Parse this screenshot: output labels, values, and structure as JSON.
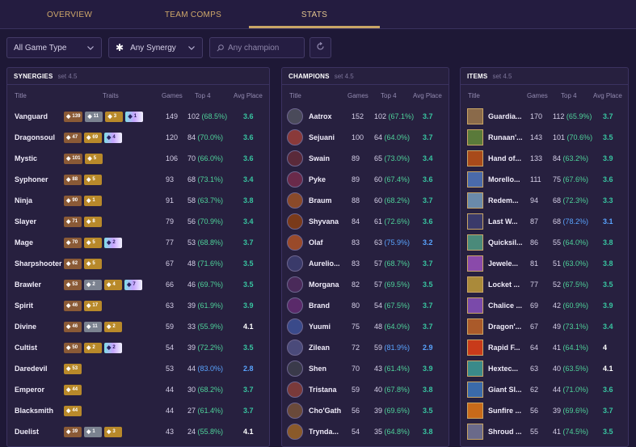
{
  "nav": {
    "tabs": [
      {
        "label": "OVERVIEW"
      },
      {
        "label": "TEAM COMPS"
      },
      {
        "label": "STATS"
      }
    ]
  },
  "filters": {
    "game_type": "All Game Type",
    "synergy": "Any Synergy",
    "champion_placeholder": "Any champion"
  },
  "synergies": {
    "title": "SYNERGIES",
    "set": "set 4.5",
    "cols": {
      "title": "Title",
      "traits": "Traits",
      "games": "Games",
      "top4": "Top 4",
      "avg": "Avg Place"
    },
    "rows": [
      {
        "name": "Vanguard",
        "traits": [
          {
            "tier": "bronze",
            "count": "139"
          },
          {
            "tier": "silver",
            "count": "11"
          },
          {
            "tier": "gold",
            "count": "3"
          },
          {
            "tier": "chromatic",
            "count": "1"
          }
        ],
        "games": "149",
        "top4": "102",
        "pct": "(68.5%)",
        "avg": "3.6"
      },
      {
        "name": "Dragonsoul",
        "traits": [
          {
            "tier": "bronze",
            "count": "47"
          },
          {
            "tier": "gold",
            "count": "69"
          },
          {
            "tier": "chromatic",
            "count": "4"
          }
        ],
        "games": "120",
        "top4": "84",
        "pct": "(70.0%)",
        "avg": "3.6"
      },
      {
        "name": "Mystic",
        "traits": [
          {
            "tier": "bronze",
            "count": "101"
          },
          {
            "tier": "gold",
            "count": "5"
          }
        ],
        "games": "106",
        "top4": "70",
        "pct": "(66.0%)",
        "avg": "3.6"
      },
      {
        "name": "Syphoner",
        "traits": [
          {
            "tier": "bronze",
            "count": "88"
          },
          {
            "tier": "gold",
            "count": "5"
          }
        ],
        "games": "93",
        "top4": "68",
        "pct": "(73.1%)",
        "avg": "3.4"
      },
      {
        "name": "Ninja",
        "traits": [
          {
            "tier": "bronze",
            "count": "90"
          },
          {
            "tier": "gold",
            "count": "1"
          }
        ],
        "games": "91",
        "top4": "58",
        "pct": "(63.7%)",
        "avg": "3.8"
      },
      {
        "name": "Slayer",
        "traits": [
          {
            "tier": "bronze",
            "count": "71"
          },
          {
            "tier": "gold",
            "count": "8"
          }
        ],
        "games": "79",
        "top4": "56",
        "pct": "(70.9%)",
        "avg": "3.4"
      },
      {
        "name": "Mage",
        "traits": [
          {
            "tier": "bronze",
            "count": "70"
          },
          {
            "tier": "gold",
            "count": "5"
          },
          {
            "tier": "chromatic",
            "count": "2"
          }
        ],
        "games": "77",
        "top4": "53",
        "pct": "(68.8%)",
        "avg": "3.7"
      },
      {
        "name": "Sharpshooter",
        "traits": [
          {
            "tier": "bronze",
            "count": "62"
          },
          {
            "tier": "gold",
            "count": "5"
          }
        ],
        "games": "67",
        "top4": "48",
        "pct": "(71.6%)",
        "avg": "3.5"
      },
      {
        "name": "Brawler",
        "traits": [
          {
            "tier": "bronze",
            "count": "53"
          },
          {
            "tier": "silver",
            "count": "2"
          },
          {
            "tier": "gold",
            "count": "4"
          },
          {
            "tier": "chromatic",
            "count": "7"
          }
        ],
        "games": "66",
        "top4": "46",
        "pct": "(69.7%)",
        "avg": "3.5"
      },
      {
        "name": "Spirit",
        "traits": [
          {
            "tier": "bronze",
            "count": "46"
          },
          {
            "tier": "gold",
            "count": "17"
          }
        ],
        "games": "63",
        "top4": "39",
        "pct": "(61.9%)",
        "avg": "3.9"
      },
      {
        "name": "Divine",
        "traits": [
          {
            "tier": "bronze",
            "count": "46"
          },
          {
            "tier": "silver",
            "count": "11"
          },
          {
            "tier": "gold",
            "count": "2"
          }
        ],
        "games": "59",
        "top4": "33",
        "pct": "(55.9%)",
        "avg": "4.1"
      },
      {
        "name": "Cultist",
        "traits": [
          {
            "tier": "bronze",
            "count": "50"
          },
          {
            "tier": "gold",
            "count": "2"
          },
          {
            "tier": "chromatic",
            "count": "2"
          }
        ],
        "games": "54",
        "top4": "39",
        "pct": "(72.2%)",
        "avg": "3.5"
      },
      {
        "name": "Daredevil",
        "traits": [
          {
            "tier": "gold",
            "count": "53"
          }
        ],
        "games": "53",
        "top4": "44",
        "pct": "(83.0%)",
        "avg": "2.8"
      },
      {
        "name": "Emperor",
        "traits": [
          {
            "tier": "gold",
            "count": "44"
          }
        ],
        "games": "44",
        "top4": "30",
        "pct": "(68.2%)",
        "avg": "3.7"
      },
      {
        "name": "Blacksmith",
        "traits": [
          {
            "tier": "gold",
            "count": "44"
          }
        ],
        "games": "44",
        "top4": "27",
        "pct": "(61.4%)",
        "avg": "3.7"
      },
      {
        "name": "Duelist",
        "traits": [
          {
            "tier": "bronze",
            "count": "39"
          },
          {
            "tier": "silver",
            "count": "1"
          },
          {
            "tier": "gold",
            "count": "3"
          }
        ],
        "games": "43",
        "top4": "24",
        "pct": "(55.8%)",
        "avg": "4.1"
      }
    ]
  },
  "champions": {
    "title": "CHAMPIONS",
    "set": "set 4.5",
    "cols": {
      "title": "Title",
      "games": "Games",
      "top4": "Top 4",
      "avg": "Avg Place"
    },
    "rows": [
      {
        "name": "Aatrox",
        "color": "#4a4a5a",
        "games": "152",
        "top4": "102",
        "pct": "(67.1%)",
        "avg": "3.7"
      },
      {
        "name": "Sejuani",
        "color": "#8a3a3a",
        "games": "100",
        "top4": "64",
        "pct": "(64.0%)",
        "avg": "3.7"
      },
      {
        "name": "Swain",
        "color": "#5a2a3a",
        "games": "89",
        "top4": "65",
        "pct": "(73.0%)",
        "avg": "3.4"
      },
      {
        "name": "Pyke",
        "color": "#6a2a4a",
        "games": "89",
        "top4": "60",
        "pct": "(67.4%)",
        "avg": "3.6"
      },
      {
        "name": "Braum",
        "color": "#8a4a2a",
        "games": "88",
        "top4": "60",
        "pct": "(68.2%)",
        "avg": "3.7"
      },
      {
        "name": "Shyvana",
        "color": "#7a3a1a",
        "games": "84",
        "top4": "61",
        "pct": "(72.6%)",
        "avg": "3.6"
      },
      {
        "name": "Olaf",
        "color": "#9a4a2a",
        "games": "83",
        "top4": "63",
        "pct": "(75.9%)",
        "avg": "3.2"
      },
      {
        "name": "Aurelio...",
        "color": "#3a3a6a",
        "games": "83",
        "top4": "57",
        "pct": "(68.7%)",
        "avg": "3.7"
      },
      {
        "name": "Morgana",
        "color": "#4a2a5a",
        "games": "82",
        "top4": "57",
        "pct": "(69.5%)",
        "avg": "3.5"
      },
      {
        "name": "Brand",
        "color": "#5a2a6a",
        "games": "80",
        "top4": "54",
        "pct": "(67.5%)",
        "avg": "3.7"
      },
      {
        "name": "Yuumi",
        "color": "#3a4a8a",
        "games": "75",
        "top4": "48",
        "pct": "(64.0%)",
        "avg": "3.7"
      },
      {
        "name": "Zilean",
        "color": "#4a4a7a",
        "games": "72",
        "top4": "59",
        "pct": "(81.9%)",
        "avg": "2.9"
      },
      {
        "name": "Shen",
        "color": "#3a3a4a",
        "games": "70",
        "top4": "43",
        "pct": "(61.4%)",
        "avg": "3.9"
      },
      {
        "name": "Tristana",
        "color": "#7a3a3a",
        "games": "59",
        "top4": "40",
        "pct": "(67.8%)",
        "avg": "3.8"
      },
      {
        "name": "Cho'Gath",
        "color": "#6a4a3a",
        "games": "56",
        "top4": "39",
        "pct": "(69.6%)",
        "avg": "3.5"
      },
      {
        "name": "Trynda...",
        "color": "#8a5a2a",
        "games": "54",
        "top4": "35",
        "pct": "(64.8%)",
        "avg": "3.8"
      }
    ]
  },
  "items": {
    "title": "ITEMS",
    "set": "set 4.5",
    "cols": {
      "title": "Title",
      "games": "Games",
      "top4": "Top 4",
      "avg": "Avg Place"
    },
    "rows": [
      {
        "name": "Guardia...",
        "color": "#8a6a4a",
        "games": "170",
        "top4": "112",
        "pct": "(65.9%)",
        "avg": "3.7"
      },
      {
        "name": "Runaan'...",
        "color": "#5a7a3a",
        "games": "143",
        "top4": "101",
        "pct": "(70.6%)",
        "avg": "3.5"
      },
      {
        "name": "Hand of...",
        "color": "#a84a1a",
        "games": "133",
        "top4": "84",
        "pct": "(63.2%)",
        "avg": "3.9"
      },
      {
        "name": "Morello...",
        "color": "#4a6aaa",
        "games": "111",
        "top4": "75",
        "pct": "(67.6%)",
        "avg": "3.6"
      },
      {
        "name": "Redem...",
        "color": "#6a8aaa",
        "games": "94",
        "top4": "68",
        "pct": "(72.3%)",
        "avg": "3.3"
      },
      {
        "name": "Last W...",
        "color": "#3a3a6a",
        "games": "87",
        "top4": "68",
        "pct": "(78.2%)",
        "avg": "3.1"
      },
      {
        "name": "Quicksil...",
        "color": "#4a8a7a",
        "games": "86",
        "top4": "55",
        "pct": "(64.0%)",
        "avg": "3.8"
      },
      {
        "name": "Jewele...",
        "color": "#8a4aaa",
        "games": "81",
        "top4": "51",
        "pct": "(63.0%)",
        "avg": "3.8"
      },
      {
        "name": "Locket ...",
        "color": "#aa8a3a",
        "games": "77",
        "top4": "52",
        "pct": "(67.5%)",
        "avg": "3.5"
      },
      {
        "name": "Chalice ...",
        "color": "#7a4aaa",
        "games": "69",
        "top4": "42",
        "pct": "(60.9%)",
        "avg": "3.9"
      },
      {
        "name": "Dragon'...",
        "color": "#aa5a2a",
        "games": "67",
        "top4": "49",
        "pct": "(73.1%)",
        "avg": "3.4"
      },
      {
        "name": "Rapid F...",
        "color": "#c83a1a",
        "games": "64",
        "top4": "41",
        "pct": "(64.1%)",
        "avg": "4"
      },
      {
        "name": "Hextec...",
        "color": "#3a8a8a",
        "games": "63",
        "top4": "40",
        "pct": "(63.5%)",
        "avg": "4.1"
      },
      {
        "name": "Giant Sl...",
        "color": "#3a6aaa",
        "games": "62",
        "top4": "44",
        "pct": "(71.0%)",
        "avg": "3.6"
      },
      {
        "name": "Sunfire ...",
        "color": "#c86a1a",
        "games": "56",
        "top4": "39",
        "pct": "(69.6%)",
        "avg": "3.7"
      },
      {
        "name": "Shroud ...",
        "color": "#6a6a8a",
        "games": "55",
        "top4": "41",
        "pct": "(74.5%)",
        "avg": "3.5"
      }
    ]
  }
}
